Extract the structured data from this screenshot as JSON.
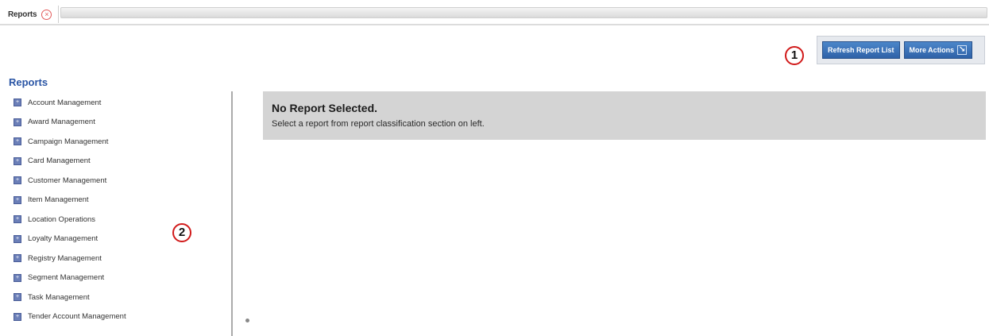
{
  "tabs": [
    {
      "label": "Reports",
      "close_icon": "close-circle-icon"
    }
  ],
  "toolbar": {
    "refresh_label": "Refresh Report List",
    "more_actions_label": "More Actions",
    "more_actions_icon": "arrow-down-right-icon"
  },
  "callouts": [
    "1",
    "2"
  ],
  "sidebar": {
    "title": "Reports",
    "item_icon": "expand-plus-icon",
    "items": [
      {
        "label": "Account Management"
      },
      {
        "label": "Award Management"
      },
      {
        "label": "Campaign Management"
      },
      {
        "label": "Card Management"
      },
      {
        "label": "Customer Management"
      },
      {
        "label": "Item Management"
      },
      {
        "label": "Location Operations"
      },
      {
        "label": "Loyalty Management"
      },
      {
        "label": "Registry Management"
      },
      {
        "label": "Segment Management"
      },
      {
        "label": "Task Management"
      },
      {
        "label": "Tender Account Management"
      }
    ]
  },
  "main": {
    "message_title": "No Report Selected.",
    "message_body": "Select a report from report classification section on left."
  },
  "colors": {
    "accent": "#2f62a8",
    "sidebar_title": "#2a55a5",
    "callout_ring": "#d11a1a",
    "message_bg": "#d4d4d4"
  }
}
